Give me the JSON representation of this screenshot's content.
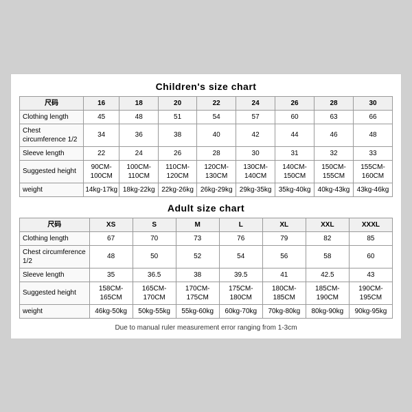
{
  "children_title": "Children's size chart",
  "adult_title": "Adult size chart",
  "footer_note": "Due to manual ruler measurement error ranging from 1-3cm",
  "children": {
    "headers": [
      "尺码",
      "16",
      "18",
      "20",
      "22",
      "24",
      "26",
      "28",
      "30"
    ],
    "rows": [
      {
        "label": "Clothing length",
        "values": [
          "45",
          "48",
          "51",
          "54",
          "57",
          "60",
          "63",
          "66"
        ]
      },
      {
        "label": "Chest circumference 1/2",
        "values": [
          "34",
          "36",
          "38",
          "40",
          "42",
          "44",
          "46",
          "48"
        ]
      },
      {
        "label": "Sleeve length",
        "values": [
          "22",
          "24",
          "26",
          "28",
          "30",
          "31",
          "32",
          "33"
        ]
      },
      {
        "label": "Suggested height",
        "values": [
          "90CM-100CM",
          "100CM-110CM",
          "110CM-120CM",
          "120CM-130CM",
          "130CM-140CM",
          "140CM-150CM",
          "150CM-155CM",
          "155CM-160CM"
        ]
      },
      {
        "label": "weight",
        "values": [
          "14kg-17kg",
          "18kg-22kg",
          "22kg-26kg",
          "26kg-29kg",
          "29kg-35kg",
          "35kg-40kg",
          "40kg-43kg",
          "43kg-46kg"
        ]
      }
    ]
  },
  "adult": {
    "headers": [
      "尺码",
      "XS",
      "S",
      "M",
      "L",
      "XL",
      "XXL",
      "XXXL"
    ],
    "rows": [
      {
        "label": "Clothing length",
        "values": [
          "67",
          "70",
          "73",
          "76",
          "79",
          "82",
          "85"
        ]
      },
      {
        "label": "Chest circumference 1/2",
        "values": [
          "48",
          "50",
          "52",
          "54",
          "56",
          "58",
          "60"
        ]
      },
      {
        "label": "Sleeve length",
        "values": [
          "35",
          "36.5",
          "38",
          "39.5",
          "41",
          "42.5",
          "43"
        ]
      },
      {
        "label": "Suggested height",
        "values": [
          "158CM-165CM",
          "165CM-170CM",
          "170CM-175CM",
          "175CM-180CM",
          "180CM-185CM",
          "185CM-190CM",
          "190CM-195CM"
        ]
      },
      {
        "label": "weight",
        "values": [
          "46kg-50kg",
          "50kg-55kg",
          "55kg-60kg",
          "60kg-70kg",
          "70kg-80kg",
          "80kg-90kg",
          "90kg-95kg"
        ]
      }
    ]
  }
}
